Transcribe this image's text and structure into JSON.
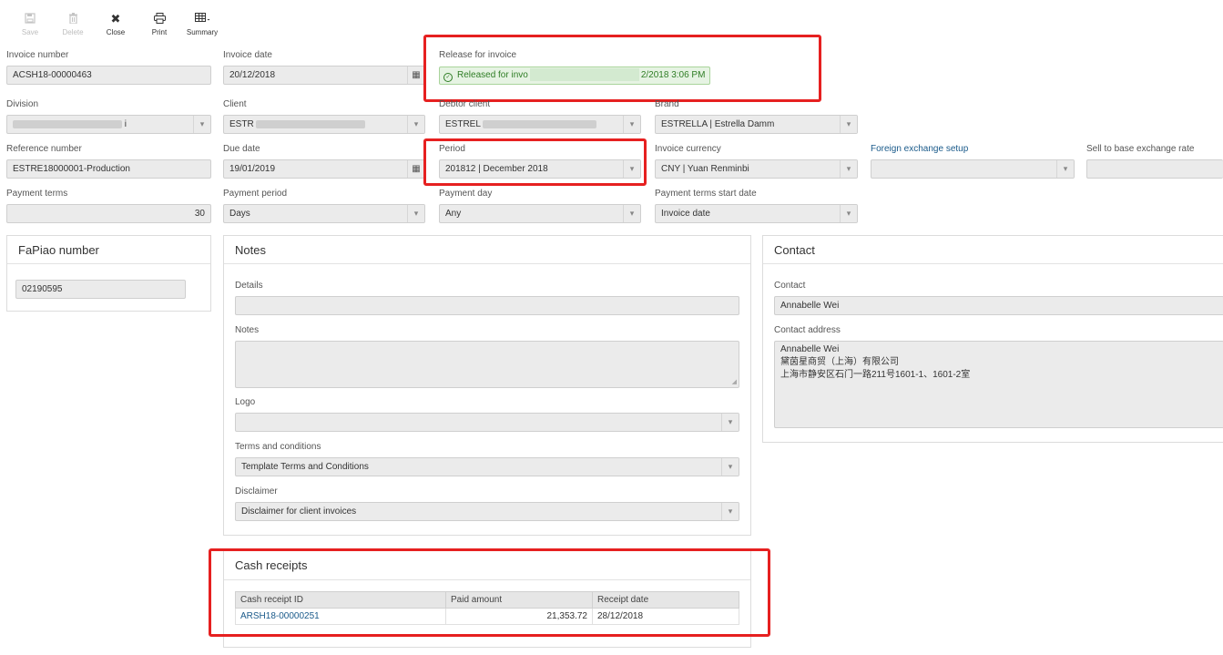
{
  "toolbar": {
    "save": "Save",
    "delete": "Delete",
    "close": "Close",
    "print": "Print",
    "summary": "Summary"
  },
  "icons": {
    "save": "floppy-disk-icon",
    "delete": "trash-icon",
    "close": "x-icon",
    "print": "printer-icon",
    "summary": "table-icon",
    "calendar": "calendar-icon",
    "dropdown": "chevron-down-icon",
    "check": "check-circle-icon"
  },
  "fields": {
    "invoice_number": {
      "label": "Invoice number",
      "value": "ACSH18-00000463"
    },
    "invoice_date": {
      "label": "Invoice date",
      "value": "20/12/2018"
    },
    "release": {
      "label": "Release for invoice",
      "value_start": "Released for invo",
      "value_end": "2/2018 3:06 PM"
    },
    "division": {
      "label": "Division",
      "value_end": "i"
    },
    "client": {
      "label": "Client",
      "value_start": "ESTR"
    },
    "debtor_client": {
      "label": "Debtor client",
      "value_start": "ESTREL"
    },
    "brand": {
      "label": "Brand",
      "value": "ESTRELLA | Estrella Damm"
    },
    "reference_number": {
      "label": "Reference number",
      "value": "ESTRE18000001-Production"
    },
    "due_date": {
      "label": "Due date",
      "value": "19/01/2019"
    },
    "period": {
      "label": "Period",
      "value": "201812 | December 2018"
    },
    "invoice_currency": {
      "label": "Invoice currency",
      "value": "CNY | Yuan Renminbi"
    },
    "fx_setup": {
      "label": "Foreign exchange setup",
      "value": ""
    },
    "sell_rate": {
      "label": "Sell to base exchange rate",
      "value": ""
    },
    "payment_terms": {
      "label": "Payment terms",
      "value": "30"
    },
    "payment_period": {
      "label": "Payment period",
      "value": "Days"
    },
    "payment_day": {
      "label": "Payment day",
      "value": "Any"
    },
    "payment_terms_start": {
      "label": "Payment terms start date",
      "value": "Invoice date"
    }
  },
  "fapiao": {
    "title": "FaPiao number",
    "value": "02190595"
  },
  "notes": {
    "title": "Notes",
    "details_label": "Details",
    "details_value": "",
    "notes_label": "Notes",
    "notes_value": "",
    "logo_label": "Logo",
    "logo_value": "",
    "terms_label": "Terms and conditions",
    "terms_value": "Template Terms and Conditions",
    "disclaimer_label": "Disclaimer",
    "disclaimer_value": "Disclaimer for client invoices"
  },
  "contact": {
    "title": "Contact",
    "contact_label": "Contact",
    "contact_value": "Annabelle Wei",
    "address_label": "Contact address",
    "address_lines": [
      "Annabelle Wei",
      "黛茵星商贸（上海）有限公司",
      "上海市静安区石门一路211号1601-1、1601-2室"
    ]
  },
  "cash_receipts": {
    "title": "Cash receipts",
    "columns": [
      "Cash receipt ID",
      "Paid amount",
      "Receipt date"
    ],
    "rows": [
      {
        "id": "ARSH18-00000251",
        "amount": "21,353.72",
        "date": "28/12/2018"
      }
    ]
  },
  "colors": {
    "highlight": "#e62020",
    "released_bg": "#e6f3e3",
    "released_text": "#2f7d25",
    "link": "#1a5a8a"
  }
}
